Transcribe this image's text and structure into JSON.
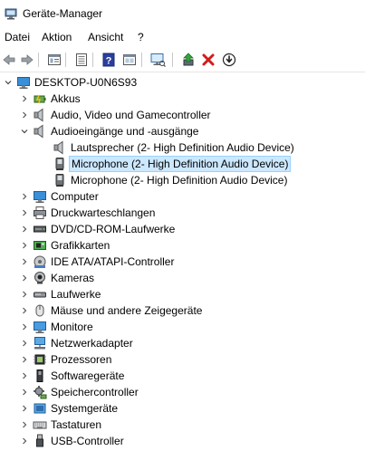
{
  "window": {
    "title": "Geräte-Manager",
    "icon": "device-manager-icon"
  },
  "menu": [
    "Datei",
    "Aktion",
    "Ansicht",
    "?"
  ],
  "toolbar": {
    "buttons": [
      "back-arrow-icon",
      "forward-arrow-icon",
      "properties-icon",
      "list-view-icon",
      "help-icon",
      "details-view-icon",
      "scan-monitor-icon",
      "update-driver-icon",
      "uninstall-icon",
      "disable-device-icon"
    ]
  },
  "tree": {
    "root": "DESKTOP-U0N6S93",
    "items": [
      {
        "label": "Akkus",
        "icon": "battery-icon"
      },
      {
        "label": "Audio, Video und Gamecontroller",
        "icon": "speaker-icon"
      },
      {
        "label": "Audioeingänge und -ausgänge",
        "icon": "speaker-icon",
        "expanded": true
      },
      {
        "label": "Lautsprecher (2- High Definition Audio Device)",
        "icon": "speaker-icon",
        "child": true
      },
      {
        "label": "Microphone (2- High Definition Audio Device)",
        "icon": "microphone-icon",
        "child": true,
        "selected": true
      },
      {
        "label": "Microphone (2- High Definition Audio Device)",
        "icon": "microphone-icon",
        "child": true
      },
      {
        "label": "Computer",
        "icon": "computer-icon"
      },
      {
        "label": "Druckwarteschlangen",
        "icon": "printer-icon"
      },
      {
        "label": "DVD/CD-ROM-Laufwerke",
        "icon": "dvd-drive-icon"
      },
      {
        "label": "Grafikkarten",
        "icon": "graphics-card-icon"
      },
      {
        "label": "IDE ATA/ATAPI-Controller",
        "icon": "ide-controller-icon"
      },
      {
        "label": "Kameras",
        "icon": "camera-icon"
      },
      {
        "label": "Laufwerke",
        "icon": "disk-drive-icon"
      },
      {
        "label": "Mäuse und andere Zeigegeräte",
        "icon": "mouse-icon"
      },
      {
        "label": "Monitore",
        "icon": "monitor-icon"
      },
      {
        "label": "Netzwerkadapter",
        "icon": "network-adapter-icon"
      },
      {
        "label": "Prozessoren",
        "icon": "processor-icon"
      },
      {
        "label": "Softwaregeräte",
        "icon": "software-device-icon"
      },
      {
        "label": "Speichercontroller",
        "icon": "storage-controller-icon"
      },
      {
        "label": "Systemgeräte",
        "icon": "system-devices-icon"
      },
      {
        "label": "Tastaturen",
        "icon": "keyboard-icon"
      },
      {
        "label": "USB-Controller",
        "icon": "usb-icon"
      }
    ]
  },
  "colors": {
    "selection_fill": "#cce8ff",
    "selection_border": "#99d1ff",
    "uninstall_red": "#d21c1c",
    "help_blue": "#2a3f9e"
  }
}
